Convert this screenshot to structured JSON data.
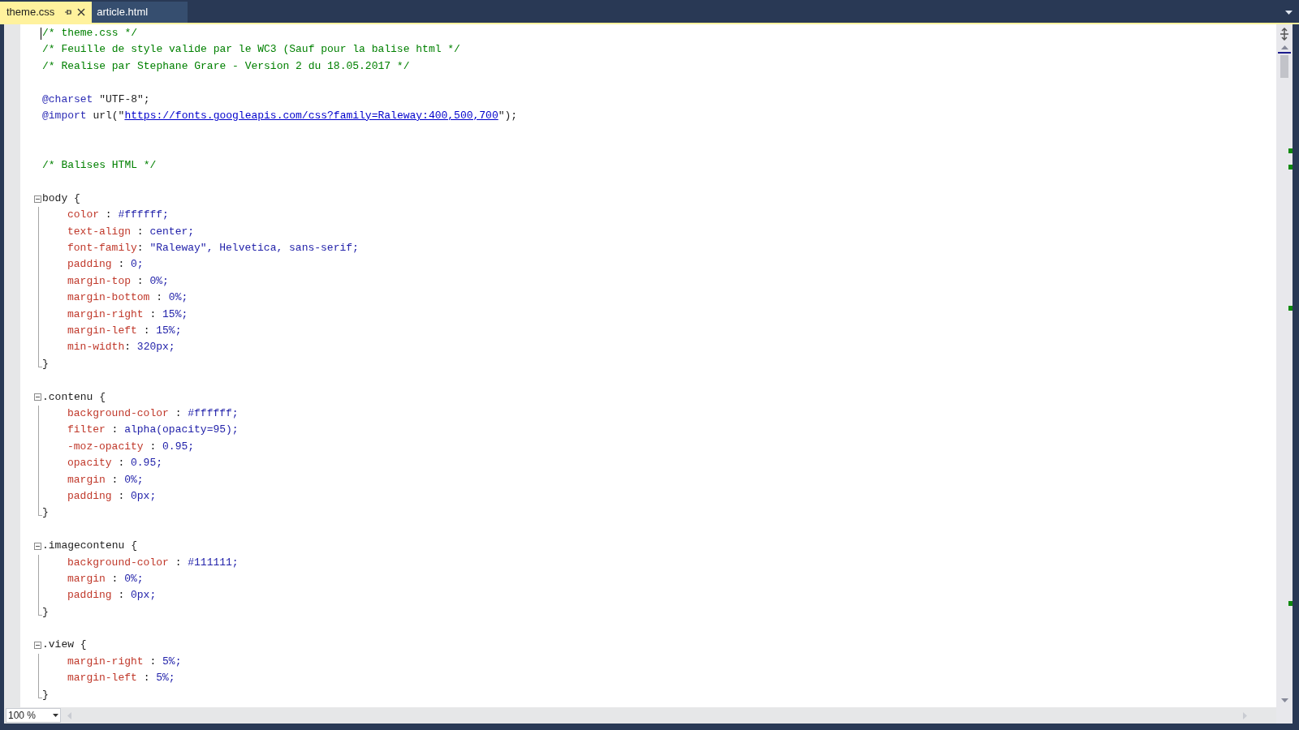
{
  "tabs": [
    {
      "label": "theme.css",
      "selected": true
    },
    {
      "label": "article.html",
      "selected": false
    }
  ],
  "code": [
    {
      "kind": "line",
      "tokens": [
        {
          "kind": "comment",
          "text": "/* theme.css */"
        }
      ]
    },
    {
      "kind": "line",
      "tokens": [
        {
          "kind": "comment",
          "text": "/* Feuille de style valide par le WC3 (Sauf pour la balise html */"
        }
      ]
    },
    {
      "kind": "line",
      "tokens": [
        {
          "kind": "comment",
          "text": "/* Realise par Stephane Grare - Version 2 du 18.05.2017 */"
        }
      ]
    },
    {
      "kind": "blank"
    },
    {
      "kind": "line",
      "tokens": [
        {
          "kind": "atrule",
          "text": "@charset"
        },
        {
          "kind": "plain",
          "text": " \"UTF-8\";"
        }
      ]
    },
    {
      "kind": "line",
      "tokens": [
        {
          "kind": "atrule",
          "text": "@import"
        },
        {
          "kind": "plain",
          "text": " url(\""
        },
        {
          "kind": "url",
          "text": "https://fonts.googleapis.com/css?family=Raleway:400,500,700"
        },
        {
          "kind": "plain",
          "text": "\");"
        }
      ]
    },
    {
      "kind": "blank"
    },
    {
      "kind": "blank"
    },
    {
      "kind": "line",
      "tokens": [
        {
          "kind": "comment",
          "text": "/* Balises HTML */"
        }
      ]
    },
    {
      "kind": "blank"
    },
    {
      "kind": "block",
      "expanded": true,
      "header": [
        {
          "kind": "selector",
          "text": "body {"
        }
      ],
      "children": [
        [
          {
            "kind": "prop",
            "text": "color"
          },
          {
            "kind": "plain",
            "text": " : "
          },
          {
            "kind": "value",
            "text": "#ffffff;"
          }
        ],
        [
          {
            "kind": "prop",
            "text": "text-align"
          },
          {
            "kind": "plain",
            "text": " : "
          },
          {
            "kind": "value",
            "text": "center;"
          }
        ],
        [
          {
            "kind": "prop",
            "text": "font-family"
          },
          {
            "kind": "plain",
            "text": ": "
          },
          {
            "kind": "value",
            "text": "\"Raleway\", Helvetica, sans-serif;"
          }
        ],
        [
          {
            "kind": "prop",
            "text": "padding"
          },
          {
            "kind": "plain",
            "text": " : "
          },
          {
            "kind": "value",
            "text": "0;"
          }
        ],
        [
          {
            "kind": "prop",
            "text": "margin-top"
          },
          {
            "kind": "plain",
            "text": " : "
          },
          {
            "kind": "value",
            "text": "0%;"
          }
        ],
        [
          {
            "kind": "prop",
            "text": "margin-bottom"
          },
          {
            "kind": "plain",
            "text": " : "
          },
          {
            "kind": "value",
            "text": "0%;"
          }
        ],
        [
          {
            "kind": "prop",
            "text": "margin-right"
          },
          {
            "kind": "plain",
            "text": " : "
          },
          {
            "kind": "value",
            "text": "15%;"
          }
        ],
        [
          {
            "kind": "prop",
            "text": "margin-left"
          },
          {
            "kind": "plain",
            "text": " : "
          },
          {
            "kind": "value",
            "text": "15%;"
          }
        ],
        [
          {
            "kind": "prop",
            "text": "min-width"
          },
          {
            "kind": "plain",
            "text": ": "
          },
          {
            "kind": "value",
            "text": "320px;"
          }
        ]
      ],
      "close": "}"
    },
    {
      "kind": "blank"
    },
    {
      "kind": "block",
      "expanded": true,
      "header": [
        {
          "kind": "selector",
          "text": ".contenu {"
        }
      ],
      "children": [
        [
          {
            "kind": "prop",
            "text": "background-color"
          },
          {
            "kind": "plain",
            "text": " : "
          },
          {
            "kind": "value",
            "text": "#ffffff;"
          }
        ],
        [
          {
            "kind": "prop",
            "text": "filter"
          },
          {
            "kind": "plain",
            "text": " : "
          },
          {
            "kind": "value",
            "text": "alpha(opacity=95);"
          }
        ],
        [
          {
            "kind": "prop",
            "text": "-moz-opacity"
          },
          {
            "kind": "plain",
            "text": " : "
          },
          {
            "kind": "value",
            "text": "0.95;"
          }
        ],
        [
          {
            "kind": "prop",
            "text": "opacity"
          },
          {
            "kind": "plain",
            "text": " : "
          },
          {
            "kind": "value",
            "text": "0.95;"
          }
        ],
        [
          {
            "kind": "prop",
            "text": "margin"
          },
          {
            "kind": "plain",
            "text": " : "
          },
          {
            "kind": "value",
            "text": "0%;"
          }
        ],
        [
          {
            "kind": "prop",
            "text": "padding"
          },
          {
            "kind": "plain",
            "text": " : "
          },
          {
            "kind": "value",
            "text": "0px;"
          }
        ]
      ],
      "close": "}"
    },
    {
      "kind": "blank"
    },
    {
      "kind": "block",
      "expanded": true,
      "header": [
        {
          "kind": "selector",
          "text": ".imagecontenu {"
        }
      ],
      "children": [
        [
          {
            "kind": "prop",
            "text": "background-color"
          },
          {
            "kind": "plain",
            "text": " : "
          },
          {
            "kind": "value",
            "text": "#111111;"
          }
        ],
        [
          {
            "kind": "prop",
            "text": "margin"
          },
          {
            "kind": "plain",
            "text": " : "
          },
          {
            "kind": "value",
            "text": "0%;"
          }
        ],
        [
          {
            "kind": "prop",
            "text": "padding"
          },
          {
            "kind": "plain",
            "text": " : "
          },
          {
            "kind": "value",
            "text": "0px;"
          }
        ]
      ],
      "close": "}"
    },
    {
      "kind": "blank"
    },
    {
      "kind": "block",
      "expanded": true,
      "header": [
        {
          "kind": "selector",
          "text": ".view {"
        }
      ],
      "children": [
        [
          {
            "kind": "prop",
            "text": "margin-right"
          },
          {
            "kind": "plain",
            "text": " : "
          },
          {
            "kind": "value",
            "text": "5%;"
          }
        ],
        [
          {
            "kind": "prop",
            "text": "margin-left"
          },
          {
            "kind": "plain",
            "text": " : "
          },
          {
            "kind": "value",
            "text": "5%;"
          }
        ]
      ],
      "close": "}"
    }
  ],
  "zoom": {
    "value": "100 %"
  }
}
